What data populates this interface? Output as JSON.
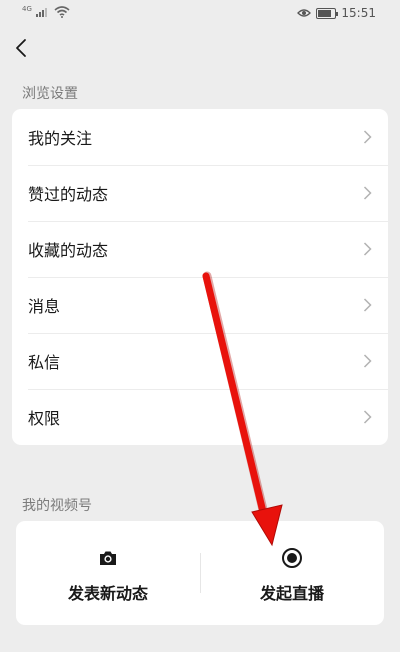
{
  "status_bar": {
    "network_label": "4G",
    "time": "15:51",
    "battery_level": 0.8
  },
  "header": {
    "back_icon": "chevron-left-icon"
  },
  "browse_settings": {
    "title": "浏览设置",
    "items": [
      {
        "label": "我的关注"
      },
      {
        "label": "赞过的动态"
      },
      {
        "label": "收藏的动态"
      },
      {
        "label": "消息"
      },
      {
        "label": "私信"
      },
      {
        "label": "权限"
      }
    ]
  },
  "channel": {
    "title": "我的视频号",
    "post_label": "发表新动态",
    "post_icon": "camera-icon",
    "live_label": "发起直播",
    "live_icon": "record-icon"
  },
  "colors": {
    "background": "#ededed",
    "card": "#ffffff",
    "annotation_arrow": "#e8120c"
  }
}
